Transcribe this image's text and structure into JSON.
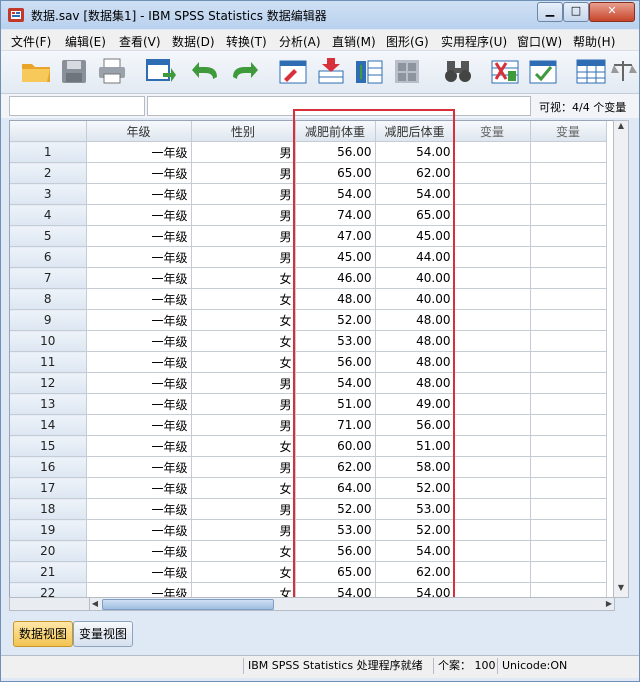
{
  "window": {
    "title": "数据.sav [数据集1] - IBM SPSS Statistics 数据编辑器",
    "minimize_label": "▁",
    "maximize_label": "□",
    "close_label": "✕"
  },
  "menu": {
    "items": [
      "文件(F)",
      "编辑(E)",
      "查看(V)",
      "数据(D)",
      "转换(T)",
      "分析(A)",
      "直销(M)",
      "图形(G)",
      "实用程序(U)",
      "窗口(W)",
      "帮助(H)"
    ]
  },
  "toolbar": {
    "icons": [
      "open-folder-icon",
      "save-disk-icon",
      "print-icon",
      "dialog-recall-icon",
      "undo-icon",
      "redo-icon",
      "goto-case-icon",
      "insert-case-icon",
      "insert-variable-icon",
      "split-file-icon",
      "find-binoculars-icon",
      "weight-cases-icon",
      "select-cases-icon",
      "value-labels-icon",
      "scale-icon"
    ]
  },
  "cell_editor": {
    "cell_name": "",
    "cell_value": "",
    "visible_count": "可视：4/4 个变量"
  },
  "grid": {
    "columns": [
      "年级",
      "性别",
      "减肥前体重",
      "减肥后体重",
      "变量",
      "变量"
    ],
    "rows": [
      {
        "n": "1",
        "grade": "一年级",
        "sex": "男",
        "before": "56.00",
        "after": "54.00"
      },
      {
        "n": "2",
        "grade": "一年级",
        "sex": "男",
        "before": "65.00",
        "after": "62.00"
      },
      {
        "n": "3",
        "grade": "一年级",
        "sex": "男",
        "before": "54.00",
        "after": "54.00"
      },
      {
        "n": "4",
        "grade": "一年级",
        "sex": "男",
        "before": "74.00",
        "after": "65.00"
      },
      {
        "n": "5",
        "grade": "一年级",
        "sex": "男",
        "before": "47.00",
        "after": "45.00"
      },
      {
        "n": "6",
        "grade": "一年级",
        "sex": "男",
        "before": "45.00",
        "after": "44.00"
      },
      {
        "n": "7",
        "grade": "一年级",
        "sex": "女",
        "before": "46.00",
        "after": "40.00"
      },
      {
        "n": "8",
        "grade": "一年级",
        "sex": "女",
        "before": "48.00",
        "after": "40.00"
      },
      {
        "n": "9",
        "grade": "一年级",
        "sex": "女",
        "before": "52.00",
        "after": "48.00"
      },
      {
        "n": "10",
        "grade": "一年级",
        "sex": "女",
        "before": "53.00",
        "after": "48.00"
      },
      {
        "n": "11",
        "grade": "一年级",
        "sex": "女",
        "before": "56.00",
        "after": "48.00"
      },
      {
        "n": "12",
        "grade": "一年级",
        "sex": "男",
        "before": "54.00",
        "after": "48.00"
      },
      {
        "n": "13",
        "grade": "一年级",
        "sex": "男",
        "before": "51.00",
        "after": "49.00"
      },
      {
        "n": "14",
        "grade": "一年级",
        "sex": "男",
        "before": "71.00",
        "after": "56.00"
      },
      {
        "n": "15",
        "grade": "一年级",
        "sex": "女",
        "before": "60.00",
        "after": "51.00"
      },
      {
        "n": "16",
        "grade": "一年级",
        "sex": "男",
        "before": "62.00",
        "after": "58.00"
      },
      {
        "n": "17",
        "grade": "一年级",
        "sex": "女",
        "before": "64.00",
        "after": "52.00"
      },
      {
        "n": "18",
        "grade": "一年级",
        "sex": "男",
        "before": "52.00",
        "after": "53.00"
      },
      {
        "n": "19",
        "grade": "一年级",
        "sex": "男",
        "before": "53.00",
        "after": "52.00"
      },
      {
        "n": "20",
        "grade": "一年级",
        "sex": "女",
        "before": "56.00",
        "after": "54.00"
      },
      {
        "n": "21",
        "grade": "一年级",
        "sex": "女",
        "before": "65.00",
        "after": "62.00"
      },
      {
        "n": "22",
        "grade": "一年级",
        "sex": "女",
        "before": "54.00",
        "after": "54.00"
      }
    ]
  },
  "tabs": {
    "data_view": "数据视图",
    "variable_view": "变量视图"
  },
  "status": {
    "processor": "IBM SPSS Statistics 处理程序就绪",
    "cases": "个案： 100",
    "unicode": "Unicode:ON"
  },
  "colors": {
    "highlight_box": "#d8303a",
    "active_tab": "#f2c351"
  }
}
